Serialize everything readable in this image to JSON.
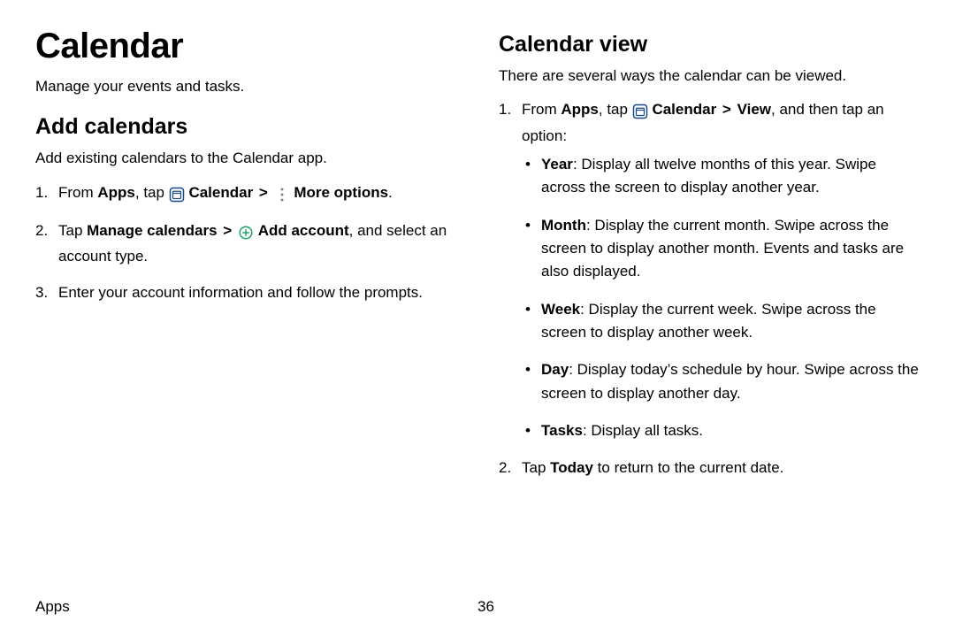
{
  "page": {
    "title": "Calendar",
    "subtitle": "Manage your events and tasks.",
    "footer_section": "Apps",
    "page_number": "36"
  },
  "left": {
    "heading": "Add calendars",
    "lead": "Add existing calendars to the Calendar app.",
    "steps": {
      "s1": {
        "from": "From ",
        "apps": "Apps",
        "tap": ", tap ",
        "calendar": "Calendar",
        "more": "More options",
        "period": "."
      },
      "s2": {
        "tap": "Tap ",
        "manage": "Manage calendars",
        "add": "Add account",
        "rest": ", and select an account type."
      },
      "s3": "Enter your account information and follow the prompts."
    }
  },
  "right": {
    "heading": "Calendar view",
    "lead": "There are several ways the calendar can be viewed.",
    "step1": {
      "from": "From ",
      "apps": "Apps",
      "tap": ", tap ",
      "calendar": "Calendar",
      "view": "View",
      "rest": ", and then tap an option:"
    },
    "bullets": {
      "year": {
        "label": "Year",
        "desc": ": Display all twelve months of this year. Swipe across the screen to display another year."
      },
      "month": {
        "label": "Month",
        "desc": ": Display the current month. Swipe across the screen to display another month. Events and tasks are also displayed."
      },
      "week": {
        "label": "Week",
        "desc": ": Display the current week. Swipe across the screen to display another week."
      },
      "day": {
        "label": "Day",
        "desc": ": Display today’s schedule by hour. Swipe across the screen to display another day."
      },
      "tasks": {
        "label": "Tasks",
        "desc": ": Display all tasks."
      }
    },
    "step2": {
      "pre": "Tap ",
      "today": "Today",
      "post": " to return to the current date."
    }
  },
  "glyphs": {
    "chevron": ">"
  }
}
